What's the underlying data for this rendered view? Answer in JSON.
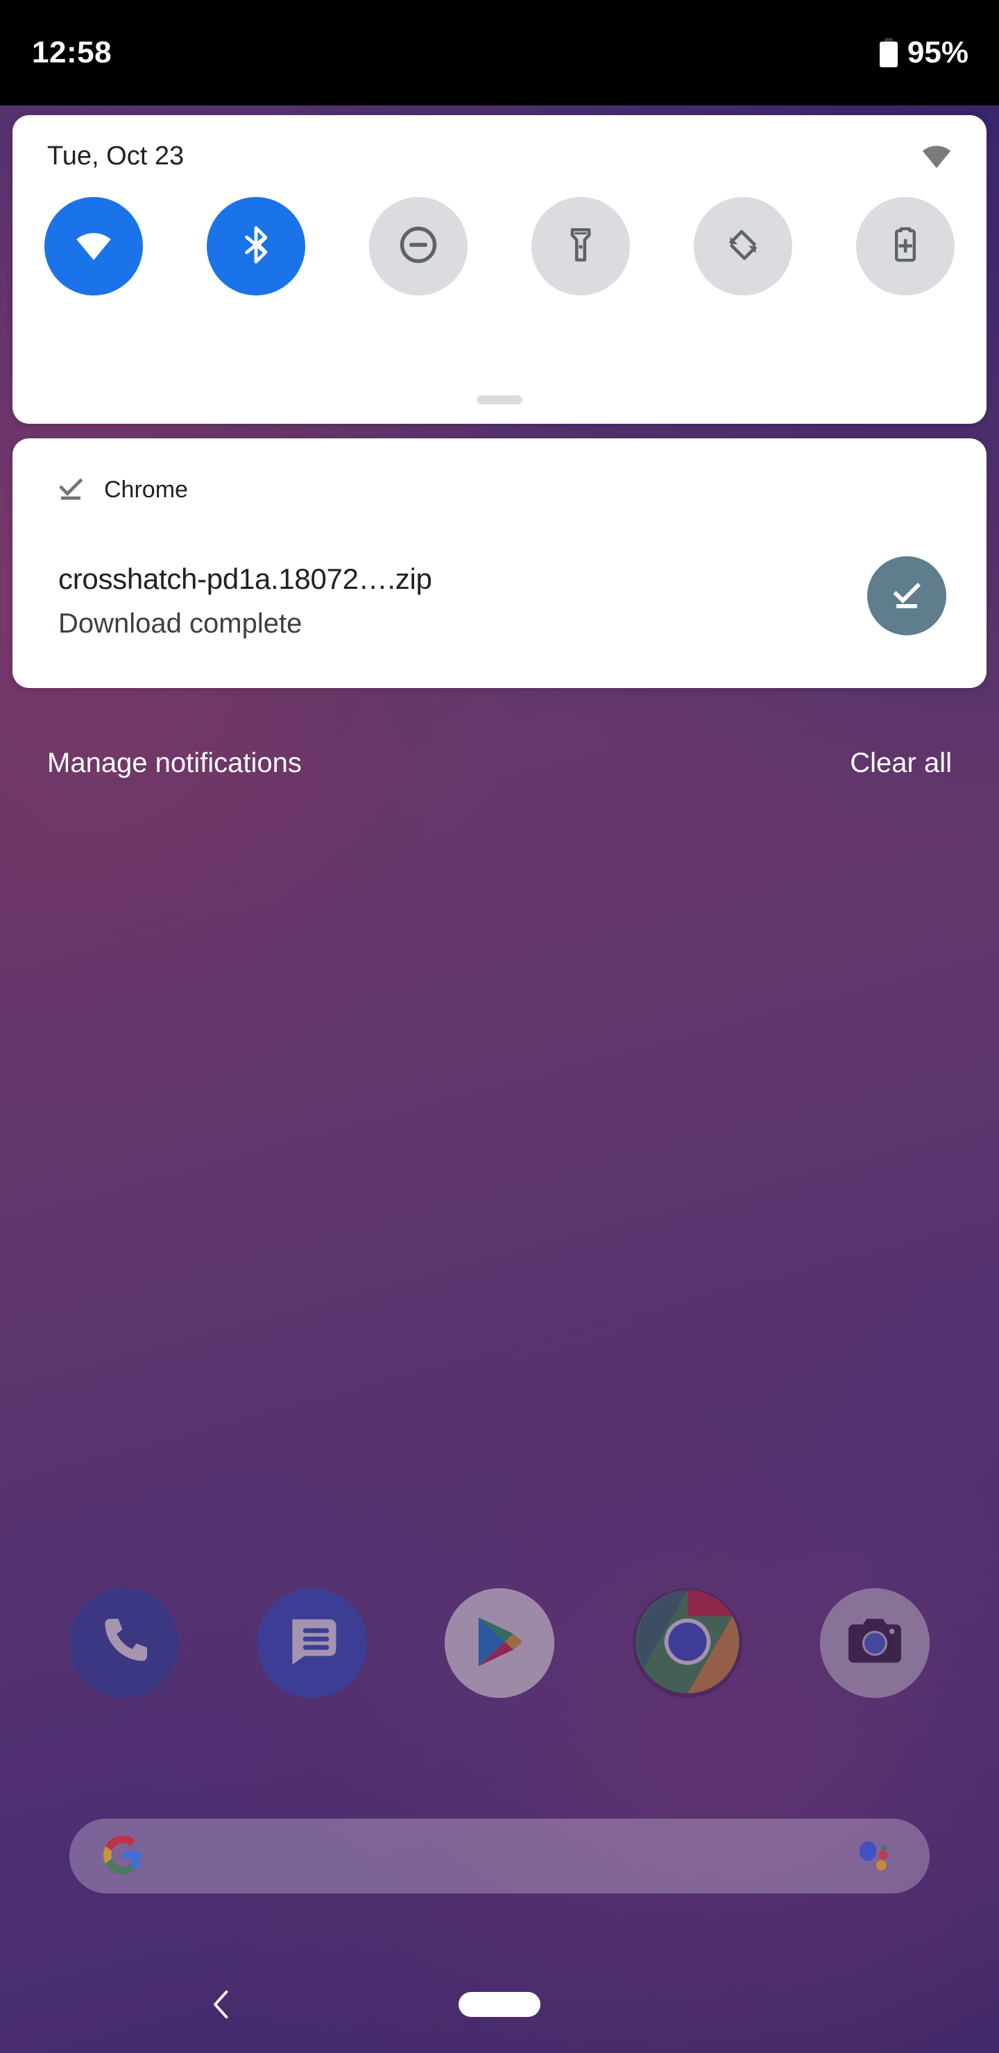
{
  "status_bar": {
    "clock": "12:58",
    "battery_percent": "95%",
    "battery_icon": "battery-full-icon"
  },
  "quick_settings": {
    "date": "Tue, Oct 23",
    "status_wifi_icon": "wifi-icon",
    "drag_handle": "quick-settings-drag-handle",
    "active_color": "#1a73e8",
    "inactive_color": "#dadce0",
    "tiles": [
      {
        "name": "wifi",
        "icon": "wifi-icon",
        "state": "on"
      },
      {
        "name": "bluetooth",
        "icon": "bluetooth-icon",
        "state": "on"
      },
      {
        "name": "do-not-disturb",
        "icon": "do-not-disturb-icon",
        "state": "off"
      },
      {
        "name": "flashlight",
        "icon": "flashlight-icon",
        "state": "off"
      },
      {
        "name": "auto-rotate",
        "icon": "auto-rotate-icon",
        "state": "off"
      },
      {
        "name": "battery-saver",
        "icon": "battery-saver-icon",
        "state": "off"
      }
    ]
  },
  "notification": {
    "app_name": "Chrome",
    "app_icon": "download-done-icon",
    "title": "crosshatch-pd1a.18072….zip",
    "subtitle": "Download complete",
    "badge_icon": "download-done-icon",
    "badge_color": "#5f7d8c"
  },
  "shade_footer": {
    "manage_label": "Manage notifications",
    "clear_label": "Clear all"
  },
  "dock": {
    "items": [
      {
        "name": "phone",
        "icon": "phone-icon"
      },
      {
        "name": "messages",
        "icon": "messages-icon"
      },
      {
        "name": "play-store",
        "icon": "play-store-icon"
      },
      {
        "name": "chrome",
        "icon": "chrome-icon"
      },
      {
        "name": "camera",
        "icon": "camera-icon"
      }
    ]
  },
  "search": {
    "value": "",
    "placeholder": "",
    "google_icon": "google-g-icon",
    "assistant_icon": "google-assistant-icon"
  },
  "nav_bar": {
    "back_icon": "back-chevron-icon",
    "home_icon": "home-pill-icon"
  }
}
